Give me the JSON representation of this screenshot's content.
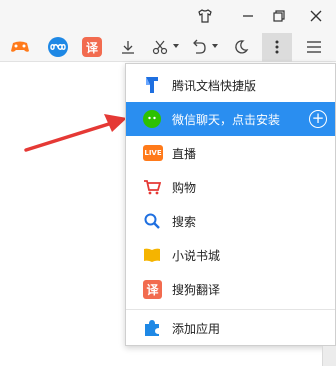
{
  "titlebar": {
    "icons": [
      "shirt-icon",
      "minimize-icon",
      "restore-icon",
      "close-icon"
    ]
  },
  "toolbar": {
    "extensions": [
      {
        "name": "game-icon",
        "color": "#ff7a1a"
      },
      {
        "name": "infinity-icon",
        "color": "#1e88e5"
      },
      {
        "name": "translate-icon",
        "color": "#f26b4f",
        "glyph": "译"
      }
    ],
    "tools": [
      "download-icon",
      "scissors-icon",
      "undo-icon",
      "moon-icon",
      "more-vertical-icon",
      "hamburger-icon"
    ]
  },
  "menu": {
    "items": [
      {
        "label": "腾讯文档快捷版",
        "icon": "tencent-docs-icon",
        "color": "#1e6fe0"
      },
      {
        "label": "微信聊天，点击安装",
        "icon": "wechat-icon",
        "color": "#2dc100",
        "highlighted": true
      },
      {
        "label": "直播",
        "icon": "live-icon",
        "color": "#ff7a1a",
        "badge": "LIVE"
      },
      {
        "label": "购物",
        "icon": "cart-icon",
        "color": "#e53935"
      },
      {
        "label": "搜索",
        "icon": "search-icon",
        "color": "#1e6fe0"
      },
      {
        "label": "小说书城",
        "icon": "book-icon",
        "color": "#f5b400"
      },
      {
        "label": "搜狗翻译",
        "icon": "sogou-translate-icon",
        "color": "#f26b4f",
        "glyph": "译"
      },
      {
        "label": "添加应用",
        "icon": "puzzle-icon",
        "color": "#1e88e5"
      }
    ]
  },
  "colors": {
    "highlight": "#2a8ef0",
    "arrow": "#e53935"
  }
}
